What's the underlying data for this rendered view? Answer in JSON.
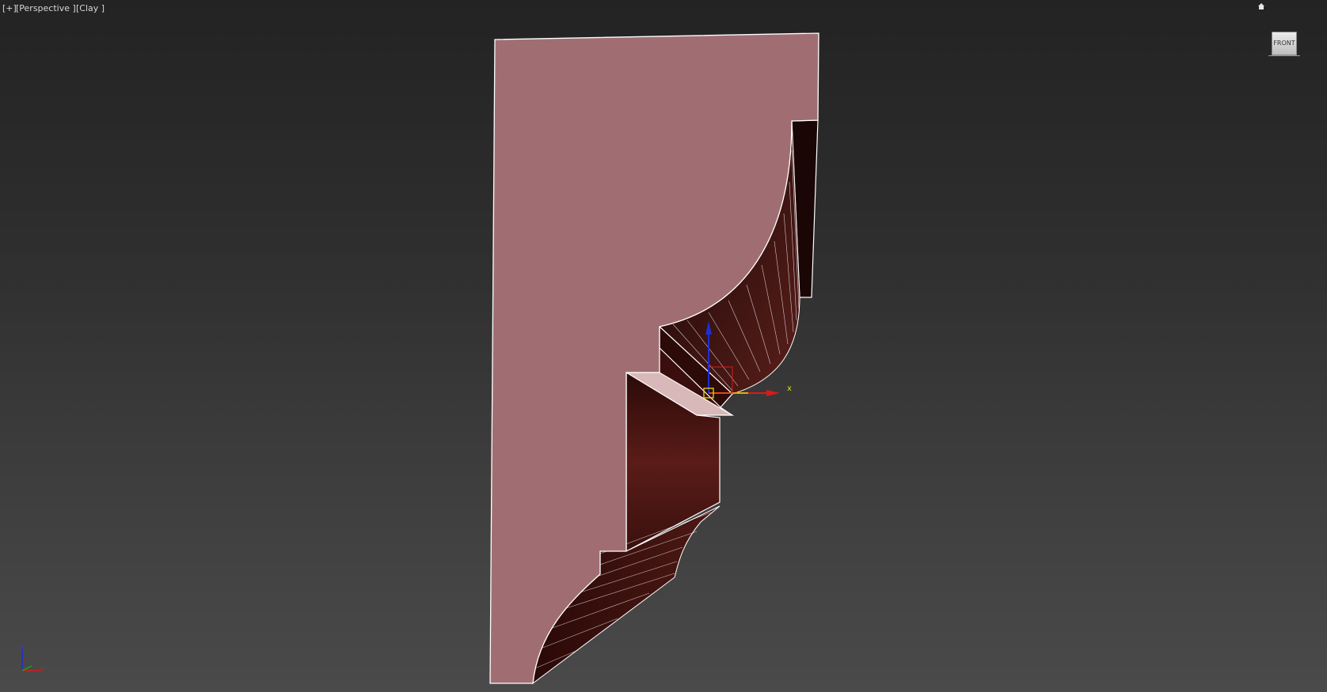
{
  "viewport": {
    "menu_label": "[+]",
    "view_label": "[Perspective ]",
    "shading_label": "[Clay ]"
  },
  "viewcube": {
    "face_label": "FRONT"
  },
  "gizmo": {
    "x_axis_label": "x"
  },
  "axis_tripod": {
    "x_label": "x",
    "z_label": "z"
  },
  "icons": [
    "home-icon",
    "viewcube-icon",
    "transform-gizmo-icon",
    "axis-tripod-icon"
  ],
  "colors": {
    "viewport_bg_top": "#232323",
    "viewport_bg_bottom": "#4a4a4a",
    "mesh_face": "#a06e72",
    "mesh_dark": "#3d1210",
    "gizmo_x": "#d41c1c",
    "gizmo_y": "#e0e000",
    "gizmo_z": "#1c2fd6"
  }
}
